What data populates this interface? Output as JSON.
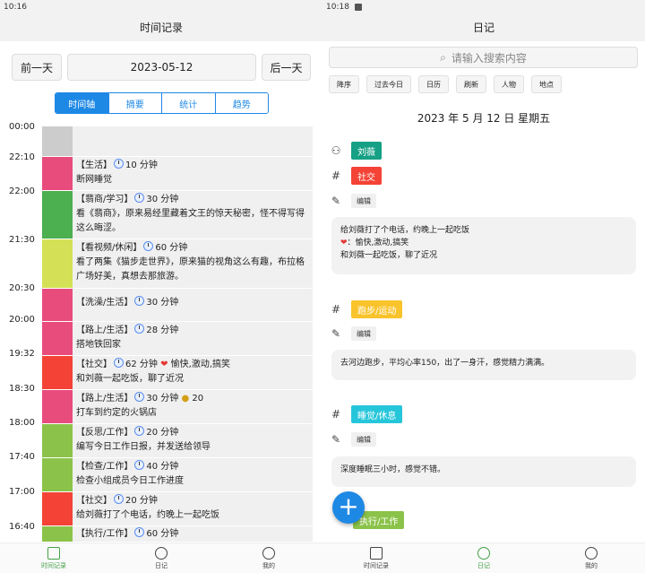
{
  "left": {
    "status_time": "10:16",
    "title": "时间记录",
    "prev_day": "前一天",
    "date": "2023-05-12",
    "next_day": "后一天",
    "tabs": [
      {
        "label": "时间轴",
        "active": true
      },
      {
        "label": "摘要",
        "active": false
      },
      {
        "label": "统计",
        "active": false
      },
      {
        "label": "趋势",
        "active": false
      }
    ],
    "time_labels": [
      "00:00",
      "22:10",
      "22:00",
      "21:30",
      "20:30",
      "20:00",
      "19:32",
      "18:30",
      "18:00",
      "17:40",
      "17:00",
      "16:40"
    ],
    "entries": [
      {
        "color": "#cccccc",
        "tag": "",
        "duration": "",
        "note": ""
      },
      {
        "color": "#e84c7d",
        "tag": "【生活】",
        "duration": "10 分钟",
        "note": "断网睡觉"
      },
      {
        "color": "#4caf50",
        "tag": "【翡商/学习】",
        "duration": "30 分钟",
        "note": "看《翡商》，原来易经里藏着文王的惊天秘密，怪不得写得这么晦涩。"
      },
      {
        "color": "#d4e157",
        "tag": "【看视频/休闲】",
        "duration": "60 分钟",
        "note": "看了两集《猫步走世界》，原来猫的视角这么有趣，布拉格广场好美，真想去那旅游。"
      },
      {
        "color": "#e84c7d",
        "tag": "【洗澡/生活】",
        "duration": "30 分钟",
        "note": ""
      },
      {
        "color": "#e84c7d",
        "tag": "【路上/生活】",
        "duration": "28 分钟",
        "note": "搭地铁回家"
      },
      {
        "color": "#f44336",
        "tag": "【社交】",
        "duration": "62 分钟",
        "extra": "愉快,激动,搞笑",
        "note": "和刘薇一起吃饭，聊了近况"
      },
      {
        "color": "#e84c7d",
        "tag": "【路上/生活】",
        "duration": "30 分钟",
        "money": "20",
        "note": "打车到约定的火锅店"
      },
      {
        "color": "#8bc34a",
        "tag": "【反思/工作】",
        "duration": "20 分钟",
        "note": "编写今日工作日报，并发送给领导"
      },
      {
        "color": "#8bc34a",
        "tag": "【检查/工作】",
        "duration": "40 分钟",
        "note": "检查小组成员今日工作进度"
      },
      {
        "color": "#f44336",
        "tag": "【社交】",
        "duration": "20 分钟",
        "note": "给刘薇打了个电话，约晚上一起吃饭"
      },
      {
        "color": "#8bc34a",
        "tag": "【执行/工作】",
        "duration": "60 分钟",
        "note": ""
      }
    ],
    "nav": [
      {
        "label": "时间记录",
        "active": true
      },
      {
        "label": "日记",
        "active": false
      },
      {
        "label": "我的",
        "active": false
      }
    ]
  },
  "right": {
    "status_time": "10:18",
    "title": "日记",
    "search_placeholder": "请输入搜索内容",
    "filters": [
      "降序",
      "过去今日",
      "日历",
      "刷新",
      "人物",
      "地点"
    ],
    "date_heading": "2023 年 5 月 12 日 星期五",
    "person_tag": "刘薇",
    "person_color": "#16a085",
    "tag_social": "社交",
    "tag_social_color": "#f44336",
    "edit_label": "编辑",
    "card1_line1": "给刘薇打了个电话，约晚上一起吃饭",
    "card1_line2": "：愉快,激动,搞笑",
    "card1_line3": "和刘薇一起吃饭，聊了近况",
    "tag_run": "跑步/运动",
    "tag_run_color": "#f9c32b",
    "card2": "去河边跑步，平均心率150，出了一身汗，感觉精力满满。",
    "tag_sleep": "睡觉/休息",
    "tag_sleep_color": "#26c6da",
    "card3": "深度睡眠三小时，感觉不错。",
    "tag_exec": "执行/工作",
    "tag_exec_color": "#8bc34a",
    "nav": [
      {
        "label": "时间记录",
        "active": false
      },
      {
        "label": "日记",
        "active": true
      },
      {
        "label": "我的",
        "active": false
      }
    ]
  }
}
